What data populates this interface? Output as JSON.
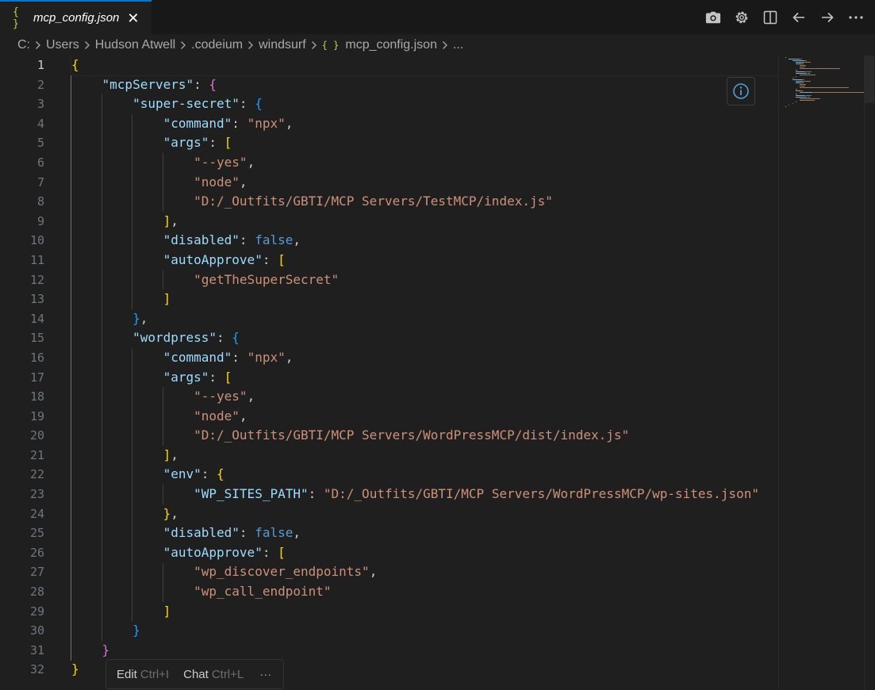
{
  "tab": {
    "icon": "{ }",
    "icon_name": "json-braces-icon",
    "label": "mcp_config.json",
    "close_label": "✕"
  },
  "toolbar": {
    "icons": [
      "camera-icon",
      "gear-icon",
      "split-editor-icon",
      "go-back-icon",
      "go-forward-icon",
      "more-actions-icon"
    ]
  },
  "breadcrumb": {
    "items": [
      "C:",
      "Users",
      "Hudson Atwell",
      ".codeium",
      "windsurf"
    ],
    "file_icon": "{ }",
    "file": "mcp_config.json",
    "trailing": "..."
  },
  "editor": {
    "active_line": 1,
    "line_numbers": [
      "1",
      "2",
      "3",
      "4",
      "5",
      "6",
      "7",
      "8",
      "9",
      "10",
      "11",
      "12",
      "13",
      "14",
      "15",
      "16",
      "17",
      "18",
      "19",
      "20",
      "21",
      "22",
      "23",
      "24",
      "25",
      "26",
      "27",
      "28",
      "29",
      "30",
      "31",
      "32"
    ],
    "lines": [
      [
        [
          "y",
          "{"
        ]
      ],
      [
        [
          "p",
          "    "
        ],
        [
          "k",
          "\"mcpServers\""
        ],
        [
          "p",
          ": "
        ],
        [
          "m",
          "{"
        ]
      ],
      [
        [
          "p",
          "        "
        ],
        [
          "k",
          "\"super-secret\""
        ],
        [
          "p",
          ": "
        ],
        [
          "bl",
          "{"
        ]
      ],
      [
        [
          "p",
          "            "
        ],
        [
          "k",
          "\"command\""
        ],
        [
          "p",
          ": "
        ],
        [
          "s",
          "\"npx\""
        ],
        [
          "p",
          ","
        ]
      ],
      [
        [
          "p",
          "            "
        ],
        [
          "k",
          "\"args\""
        ],
        [
          "p",
          ": "
        ],
        [
          "y",
          "["
        ]
      ],
      [
        [
          "p",
          "                "
        ],
        [
          "s",
          "\"--yes\""
        ],
        [
          "p",
          ","
        ]
      ],
      [
        [
          "p",
          "                "
        ],
        [
          "s",
          "\"node\""
        ],
        [
          "p",
          ","
        ]
      ],
      [
        [
          "p",
          "                "
        ],
        [
          "s",
          "\"D:/_Outfits/GBTI/MCP Servers/TestMCP/index.js\""
        ]
      ],
      [
        [
          "p",
          "            "
        ],
        [
          "y",
          "]"
        ],
        [
          "p",
          ","
        ]
      ],
      [
        [
          "p",
          "            "
        ],
        [
          "k",
          "\"disabled\""
        ],
        [
          "p",
          ": "
        ],
        [
          "b",
          "false"
        ],
        [
          "p",
          ","
        ]
      ],
      [
        [
          "p",
          "            "
        ],
        [
          "k",
          "\"autoApprove\""
        ],
        [
          "p",
          ": "
        ],
        [
          "y",
          "["
        ]
      ],
      [
        [
          "p",
          "                "
        ],
        [
          "s",
          "\"getTheSuperSecret\""
        ]
      ],
      [
        [
          "p",
          "            "
        ],
        [
          "y",
          "]"
        ]
      ],
      [
        [
          "p",
          "        "
        ],
        [
          "bl",
          "}"
        ],
        [
          "p",
          ","
        ]
      ],
      [
        [
          "p",
          "        "
        ],
        [
          "k",
          "\"wordpress\""
        ],
        [
          "p",
          ": "
        ],
        [
          "bl",
          "{"
        ]
      ],
      [
        [
          "p",
          "            "
        ],
        [
          "k",
          "\"command\""
        ],
        [
          "p",
          ": "
        ],
        [
          "s",
          "\"npx\""
        ],
        [
          "p",
          ","
        ]
      ],
      [
        [
          "p",
          "            "
        ],
        [
          "k",
          "\"args\""
        ],
        [
          "p",
          ": "
        ],
        [
          "y",
          "["
        ]
      ],
      [
        [
          "p",
          "                "
        ],
        [
          "s",
          "\"--yes\""
        ],
        [
          "p",
          ","
        ]
      ],
      [
        [
          "p",
          "                "
        ],
        [
          "s",
          "\"node\""
        ],
        [
          "p",
          ","
        ]
      ],
      [
        [
          "p",
          "                "
        ],
        [
          "s",
          "\"D:/_Outfits/GBTI/MCP Servers/WordPressMCP/dist/index.js\""
        ]
      ],
      [
        [
          "p",
          "            "
        ],
        [
          "y",
          "]"
        ],
        [
          "p",
          ","
        ]
      ],
      [
        [
          "p",
          "            "
        ],
        [
          "k",
          "\"env\""
        ],
        [
          "p",
          ": "
        ],
        [
          "y",
          "{"
        ]
      ],
      [
        [
          "p",
          "                "
        ],
        [
          "k",
          "\"WP_SITES_PATH\""
        ],
        [
          "p",
          ": "
        ],
        [
          "s",
          "\"D:/_Outfits/GBTI/MCP Servers/WordPressMCP/wp-sites.json\""
        ]
      ],
      [
        [
          "p",
          "            "
        ],
        [
          "y",
          "}"
        ],
        [
          "p",
          ","
        ]
      ],
      [
        [
          "p",
          "            "
        ],
        [
          "k",
          "\"disabled\""
        ],
        [
          "p",
          ": "
        ],
        [
          "b",
          "false"
        ],
        [
          "p",
          ","
        ]
      ],
      [
        [
          "p",
          "            "
        ],
        [
          "k",
          "\"autoApprove\""
        ],
        [
          "p",
          ": "
        ],
        [
          "y",
          "["
        ]
      ],
      [
        [
          "p",
          "                "
        ],
        [
          "s",
          "\"wp_discover_endpoints\""
        ],
        [
          "p",
          ","
        ]
      ],
      [
        [
          "p",
          "                "
        ],
        [
          "s",
          "\"wp_call_endpoint\""
        ]
      ],
      [
        [
          "p",
          "            "
        ],
        [
          "y",
          "]"
        ]
      ],
      [
        [
          "p",
          "        "
        ],
        [
          "bl",
          "}"
        ]
      ],
      [
        [
          "p",
          "    "
        ],
        [
          "m",
          "}"
        ]
      ],
      [
        [
          "y",
          "}"
        ]
      ]
    ]
  },
  "info_button": {
    "icon": "info-icon"
  },
  "hint_bar": {
    "edit_label": "Edit",
    "edit_shortcut": "Ctrl+I",
    "chat_label": "Chat",
    "chat_shortcut": "Ctrl+L",
    "more_label": "···"
  },
  "colors": {
    "accent": "#0078d4",
    "key": "#9cdcfe",
    "string": "#ce9178",
    "keyword": "#569cd6",
    "bracket_gold": "#ffd700",
    "bracket_magenta": "#da70d6",
    "bracket_blue": "#179fff"
  }
}
